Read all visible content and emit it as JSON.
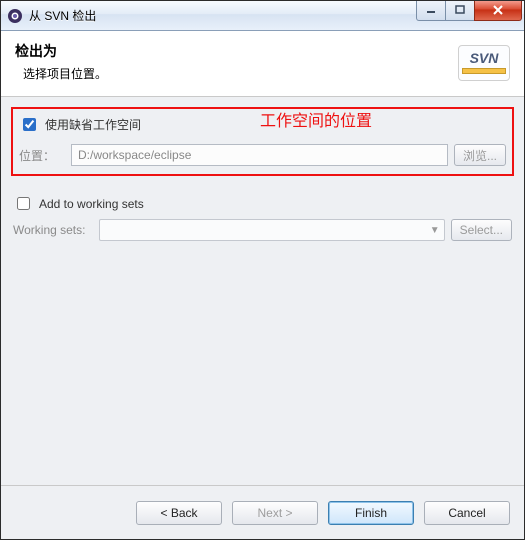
{
  "window": {
    "title": "从 SVN 检出"
  },
  "header": {
    "title": "检出为",
    "subtitle": "选择项目位置。",
    "logo_text": "SVN"
  },
  "workspace": {
    "use_default_label": "使用缺省工作空间",
    "use_default_checked": true,
    "location_label": "位置：",
    "location_value": "D:/workspace/eclipse",
    "browse_label": "浏览..."
  },
  "annotation": {
    "text": "工作空间的位置"
  },
  "working_sets": {
    "add_label": "Add to working sets",
    "add_checked": false,
    "label": "Working sets:",
    "selected": "",
    "select_button": "Select..."
  },
  "buttons": {
    "back": "< Back",
    "next": "Next >",
    "finish": "Finish",
    "cancel": "Cancel"
  }
}
